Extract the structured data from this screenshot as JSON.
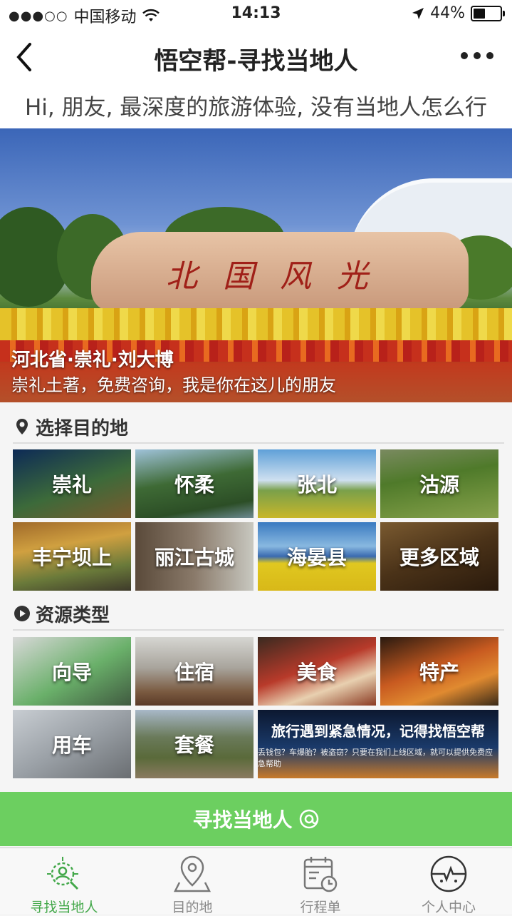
{
  "status_bar": {
    "signal": "●●●○○",
    "carrier": "中国移动",
    "time": "14:13",
    "battery": "44%",
    "battery_level": 0.44
  },
  "nav": {
    "title": "悟空帮-寻找当地人"
  },
  "tagline": "Hi, 朋友, 最深度的旅游体验, 没有当地人怎么行",
  "hero": {
    "stone_text": "北国风光",
    "title": "河北省·崇礼·刘大博",
    "subtitle": "崇礼土著，免费咨询，我是你在这儿的朋友"
  },
  "destinations": {
    "heading": "选择目的地",
    "items": [
      {
        "label": "崇礼",
        "bg": "linear-gradient(160deg,#0d2a56,#3c6a3a 55%,#7a5a2e)"
      },
      {
        "label": "怀柔",
        "bg": "linear-gradient(170deg,#9fc2d9,#3e6a35 45%,#2c4e26 80%,#6d8a92)"
      },
      {
        "label": "张北",
        "bg": "linear-gradient(180deg,#5fa0d8,#cfe0f0 45%,#7aa04a 60%,#c8b62a)"
      },
      {
        "label": "沽源",
        "bg": "linear-gradient(170deg,#7a8a60,#4f7a2a 40%,#6b8e3a 70%,#86a04c)"
      },
      {
        "label": "丰宁坝上",
        "bg": "linear-gradient(170deg,#a06a2a,#d0a040 35%,#6a7a3a 70%,#3e3a2a)"
      },
      {
        "label": "丽江古城",
        "bg": "linear-gradient(90deg,#5a4a3a,#8a7a6a 50%,#c8c8c0)"
      },
      {
        "label": "海晏县",
        "bg": "linear-gradient(180deg,#3a7ac0,#88b8e0 35%,#3a6ab0 50%,#e0c820 60%,#d8b818)"
      },
      {
        "label": "更多区域",
        "bg": "linear-gradient(160deg,#7a5a30,#4a3218 50%,#2a1a0c)"
      }
    ]
  },
  "resources": {
    "heading": "资源类型",
    "items": [
      {
        "label": "向导",
        "bg": "linear-gradient(150deg,#d8d8d8,#6ab06a 55%,#405a40)"
      },
      {
        "label": "住宿",
        "bg": "linear-gradient(180deg,#d6d6d2,#a8a49c 45%,#7a5a40 80%,#5a3a28)"
      },
      {
        "label": "美食",
        "bg": "linear-gradient(160deg,#3a2a20,#b83a2a 45%,#e8d0b0 70%,#8a3a22)"
      },
      {
        "label": "特产",
        "bg": "linear-gradient(160deg,#2a1a10,#c85a20 45%,#e08a30 70%,#3a2a18)"
      },
      {
        "label": "用车",
        "bg": "linear-gradient(150deg,#c8cdd2,#9aa0a6 50%,#6a6e72)"
      },
      {
        "label": "套餐",
        "bg": "linear-gradient(180deg,#a8b8c8,#6a7a5a 40%,#5a6a3a 70%,#8a7a60)"
      }
    ],
    "banner": {
      "line1": "旅行遇到紧急情况，记得找悟空帮",
      "line2": "丢钱包？车爆胎？被盗窃？只要在我们上线区域，就可以提供免费应急帮助",
      "bg": "linear-gradient(180deg,#0c1830,#1a3a6a 55%,#c87a2a)"
    }
  },
  "cta": {
    "label": "寻找当地人"
  },
  "tabs": [
    {
      "label": "寻找当地人",
      "active": true
    },
    {
      "label": "目的地",
      "active": false
    },
    {
      "label": "行程单",
      "active": false
    },
    {
      "label": "个人中心",
      "active": false
    }
  ],
  "colors": {
    "accent": "#6ccf60",
    "tab_active": "#43a84a"
  }
}
